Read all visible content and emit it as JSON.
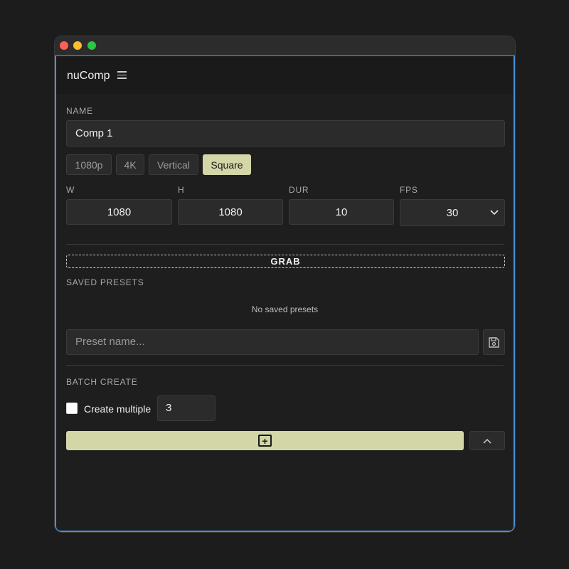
{
  "app": {
    "title": "nuComp"
  },
  "name_section": {
    "label": "NAME",
    "value": "Comp 1"
  },
  "presets": [
    {
      "label": "1080p",
      "active": false
    },
    {
      "label": "4K",
      "active": false
    },
    {
      "label": "Vertical",
      "active": false
    },
    {
      "label": "Square",
      "active": true
    }
  ],
  "dimensions": {
    "w_label": "W",
    "w_value": "1080",
    "h_label": "H",
    "h_value": "1080",
    "dur_label": "DUR",
    "dur_value": "10",
    "fps_label": "FPS",
    "fps_value": "30"
  },
  "grab": {
    "label": "GRAB"
  },
  "saved_presets": {
    "label": "SAVED PRESETS",
    "empty_text": "No saved presets",
    "input_placeholder": "Preset name..."
  },
  "batch": {
    "label": "BATCH CREATE",
    "checkbox_label": "Create multiple",
    "count": "3"
  },
  "create": {
    "icon_glyph": "+"
  },
  "icons": {
    "menu": "menu-icon",
    "save": "save-icon",
    "chevron_down": "chevron-down-icon",
    "chevron_up": "chevron-up-icon",
    "plus": "plus-square-icon"
  },
  "colors": {
    "accent": "#d3d6a6",
    "focus_border": "#4a90d9"
  }
}
